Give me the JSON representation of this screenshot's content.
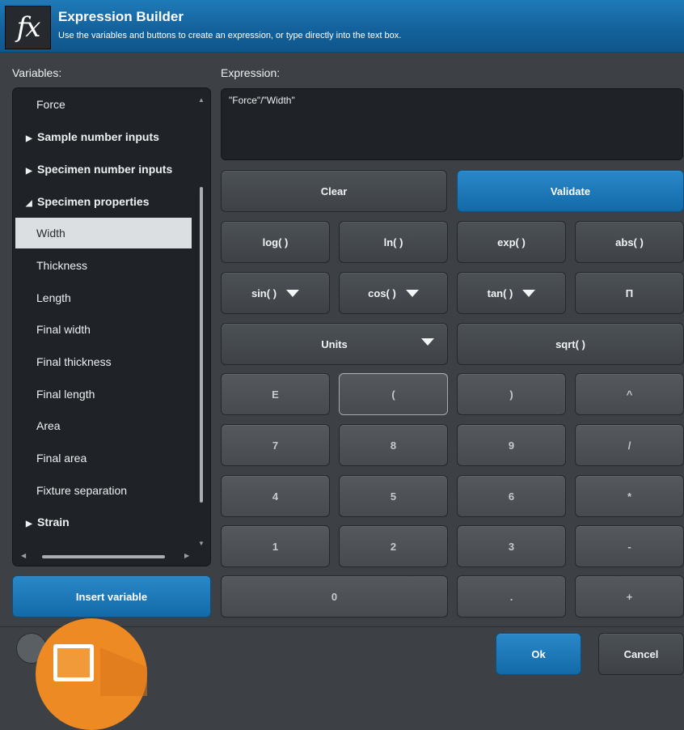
{
  "header": {
    "icon_text": "fx",
    "title": "Expression Builder",
    "subtitle": "Use the variables and buttons to create an expression, or type directly into the text box."
  },
  "variables": {
    "label": "Variables:",
    "items": [
      {
        "label": "Force",
        "type": "item"
      },
      {
        "label": "Sample number inputs",
        "type": "group",
        "expanded": false
      },
      {
        "label": "Specimen number inputs",
        "type": "group",
        "expanded": false
      },
      {
        "label": "Specimen properties",
        "type": "group",
        "expanded": true
      },
      {
        "label": "Width",
        "type": "item",
        "selected": true
      },
      {
        "label": "Thickness",
        "type": "item"
      },
      {
        "label": "Length",
        "type": "item"
      },
      {
        "label": "Final width",
        "type": "item"
      },
      {
        "label": "Final thickness",
        "type": "item"
      },
      {
        "label": "Final length",
        "type": "item"
      },
      {
        "label": "Area",
        "type": "item"
      },
      {
        "label": "Final area",
        "type": "item"
      },
      {
        "label": "Fixture separation",
        "type": "item"
      },
      {
        "label": "Strain",
        "type": "group",
        "expanded": false
      }
    ],
    "insert_label": "Insert variable"
  },
  "expression": {
    "label": "Expression:",
    "value": "\"Force\"/\"Width\""
  },
  "actions": {
    "clear": "Clear",
    "validate": "Validate"
  },
  "functions": {
    "log": "log( )",
    "ln": "ln( )",
    "exp": "exp( )",
    "abs": "abs( )",
    "sin": "sin( )",
    "cos": "cos( )",
    "tan": "tan( )",
    "pi": "Π",
    "units": "Units",
    "sqrt": "sqrt( )"
  },
  "keypad": {
    "E": "E",
    "open_paren": "(",
    "close_paren": ")",
    "power": "^",
    "7": "7",
    "8": "8",
    "9": "9",
    "divide": "/",
    "4": "4",
    "5": "5",
    "6": "6",
    "multiply": "*",
    "1": "1",
    "2": "2",
    "3": "3",
    "minus": "-",
    "0": "0",
    "dot": ".",
    "plus": "+"
  },
  "footer": {
    "ok": "Ok",
    "cancel": "Cancel"
  },
  "colors": {
    "header_blue": "#13609a",
    "accent_blue": "#1a77b8",
    "panel_dark": "#1f2327",
    "background": "#3d4145",
    "badge_orange": "#ee8a24"
  }
}
